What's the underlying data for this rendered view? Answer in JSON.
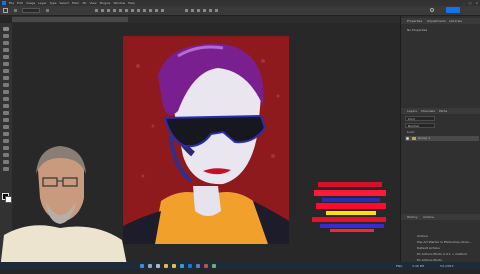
{
  "app": {
    "menus": [
      "File",
      "Edit",
      "Image",
      "Layer",
      "Type",
      "Select",
      "Filter",
      "3D",
      "View",
      "Plugins",
      "Window",
      "Help"
    ],
    "share_label": "Share"
  },
  "tabs": [
    {
      "label": "Pop Art Warhol Portrait CC 2023 Tut 16.1.psd @ 100% (Group 1, RGB/8#)",
      "active": true
    },
    {
      "label": "Illustration_2.psd @ 66.7%",
      "active": false
    }
  ],
  "right_panel": {
    "tabs": [
      "Properties",
      "Adjustments",
      "Libraries"
    ],
    "properties_text": "No Properties",
    "layers_tabs": [
      "Layers",
      "Channels",
      "Paths"
    ],
    "layer_kind": "Kind",
    "blend_mode": "Normal",
    "lock_label": "Lock:",
    "layers": [
      {
        "name": "Group 1",
        "selected": true
      }
    ],
    "history_tabs": [
      "History",
      "Actions"
    ],
    "history_items": [
      "Actions",
      "Pop Art Warhol in Photoshop (Over...",
      "Default Actions",
      "Ex Actions Photo 2-4.1 + method",
      "Ex Actions Photo",
      "Ex Actions Photo"
    ]
  },
  "taskbar": {
    "lang": "ENG",
    "time": "3:48 PM",
    "date": "5/1/2023"
  },
  "colors": {
    "canvas_red": "#8e1a1e",
    "accent_blue": "#1473e6"
  }
}
